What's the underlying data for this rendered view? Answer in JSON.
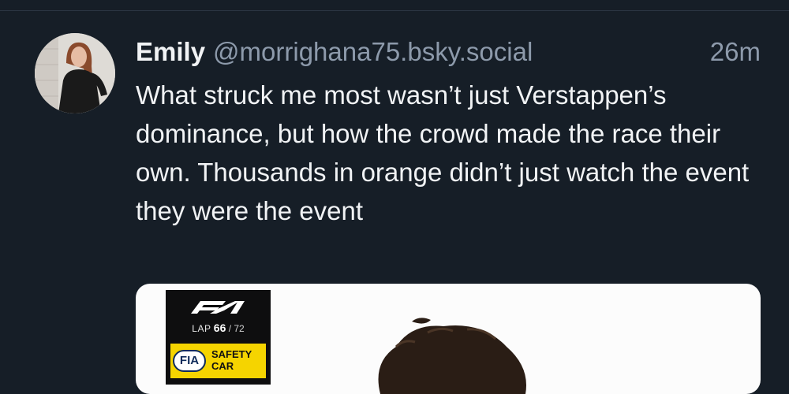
{
  "post": {
    "author_name": "Emily",
    "author_handle": "@morrighana75.bsky.social",
    "time": "26m",
    "text": "What struck me most wasn’t just Verstappen’s dominance, but how the crowd made the race their own. Thousands in orange didn’t just watch the event they were the event",
    "avatar_icon": "user-avatar-photo"
  },
  "media": {
    "lap_label": "LAP",
    "lap_current": "66",
    "lap_total": "/ 72",
    "badge_text": "FIA",
    "status_line1": "SAFETY",
    "status_line2": "CAR",
    "logo_icon": "f1-logo-icon",
    "colors": {
      "safety_yellow": "#f5d400",
      "panel_black": "#0e0e0f"
    }
  },
  "colors": {
    "background": "#161e27",
    "text_primary": "#f1f3f5",
    "text_secondary": "#8d9aab"
  }
}
